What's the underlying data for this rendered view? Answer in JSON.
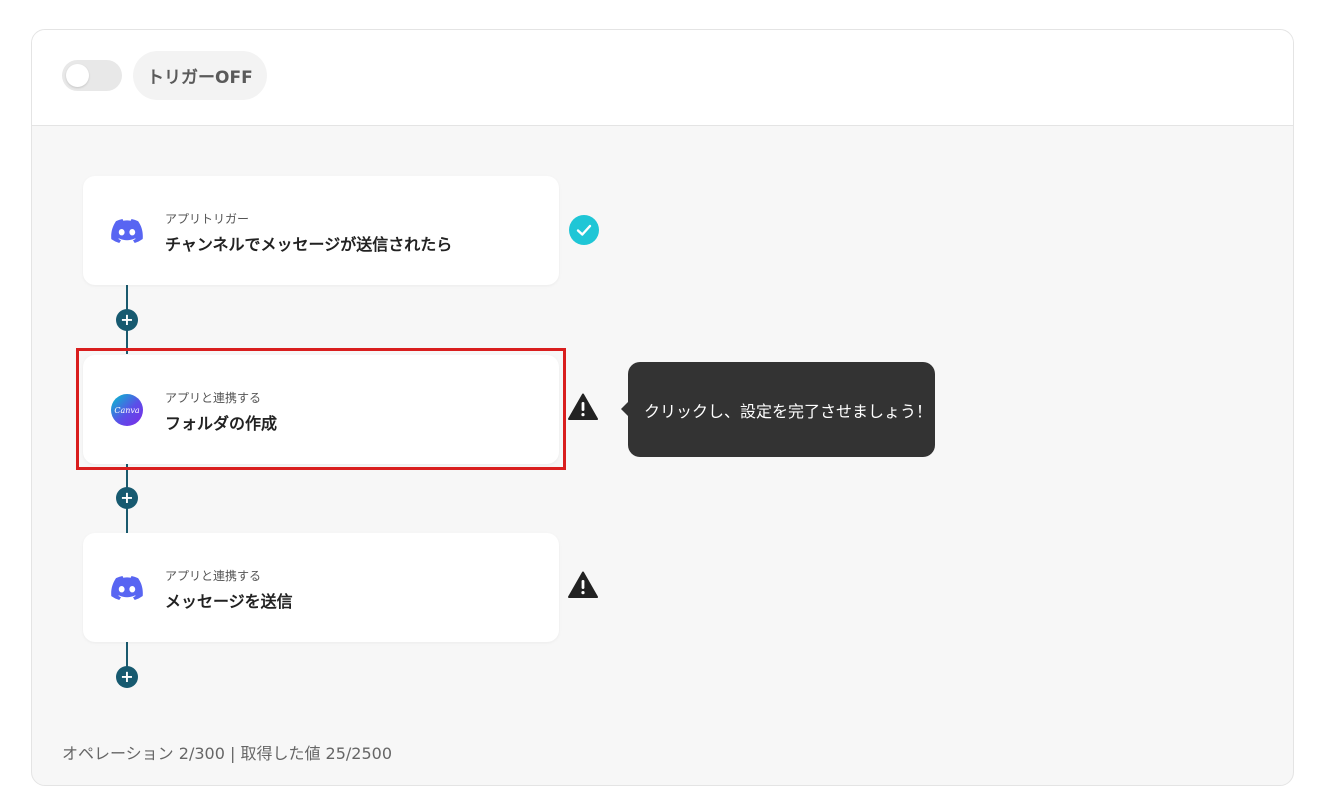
{
  "header": {
    "trigger_toggle": {
      "state": "off"
    },
    "trigger_label": "トリガーOFF"
  },
  "steps": [
    {
      "kind": "アプリトリガー",
      "title": "チャンネルでメッセージが送信されたら",
      "app_icon": "discord-icon",
      "status": "complete"
    },
    {
      "kind": "アプリと連携する",
      "title": "フォルダの作成",
      "app_icon": "canva-icon",
      "canva_logo_text": "Canva",
      "status": "warning"
    },
    {
      "kind": "アプリと連携する",
      "title": "メッセージを送信",
      "app_icon": "discord-icon",
      "status": "warning"
    }
  ],
  "tooltip": {
    "text": "クリックし、設定を完了させましょう！"
  },
  "footer": {
    "usage": "オペレーション 2/300 | 取得した値 25/2500"
  },
  "colors": {
    "accent_teal": "#175a70",
    "check_cyan": "#1fc6d6",
    "discord": "#5865f2",
    "highlight_red": "#d91e1e"
  }
}
